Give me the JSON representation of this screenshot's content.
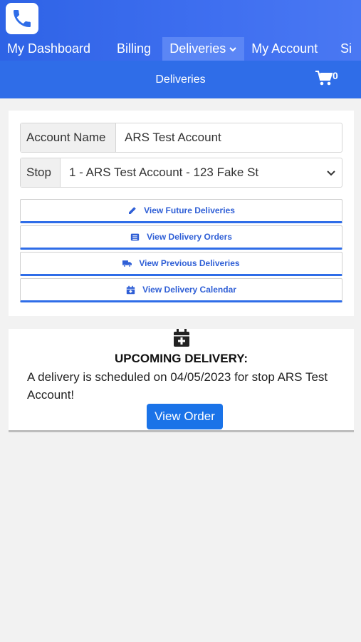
{
  "nav": {
    "items": [
      {
        "label": "My Dashboard"
      },
      {
        "label": "Billing"
      },
      {
        "label": "Deliveries"
      },
      {
        "label": "My Account"
      },
      {
        "label": "Si"
      }
    ]
  },
  "subheader": {
    "title": "Deliveries",
    "cart_count": "0"
  },
  "account": {
    "account_name_label": "Account Name",
    "account_name_value": "ARS Test Account",
    "stop_label": "Stop",
    "stop_value": "1 - ARS Test Account - 123 Fake St"
  },
  "actions": {
    "future": "View Future Deliveries",
    "orders": "View Delivery Orders",
    "previous": "View Previous Deliveries",
    "calendar": "View Delivery Calendar"
  },
  "upcoming": {
    "title": "UPCOMING DELIVERY:",
    "message": "A delivery is scheduled on 04/05/2023 for stop ARS Test Account!",
    "button": "View Order"
  },
  "colors": {
    "primary": "#2f6de8",
    "button_blue": "#1a73e8"
  }
}
